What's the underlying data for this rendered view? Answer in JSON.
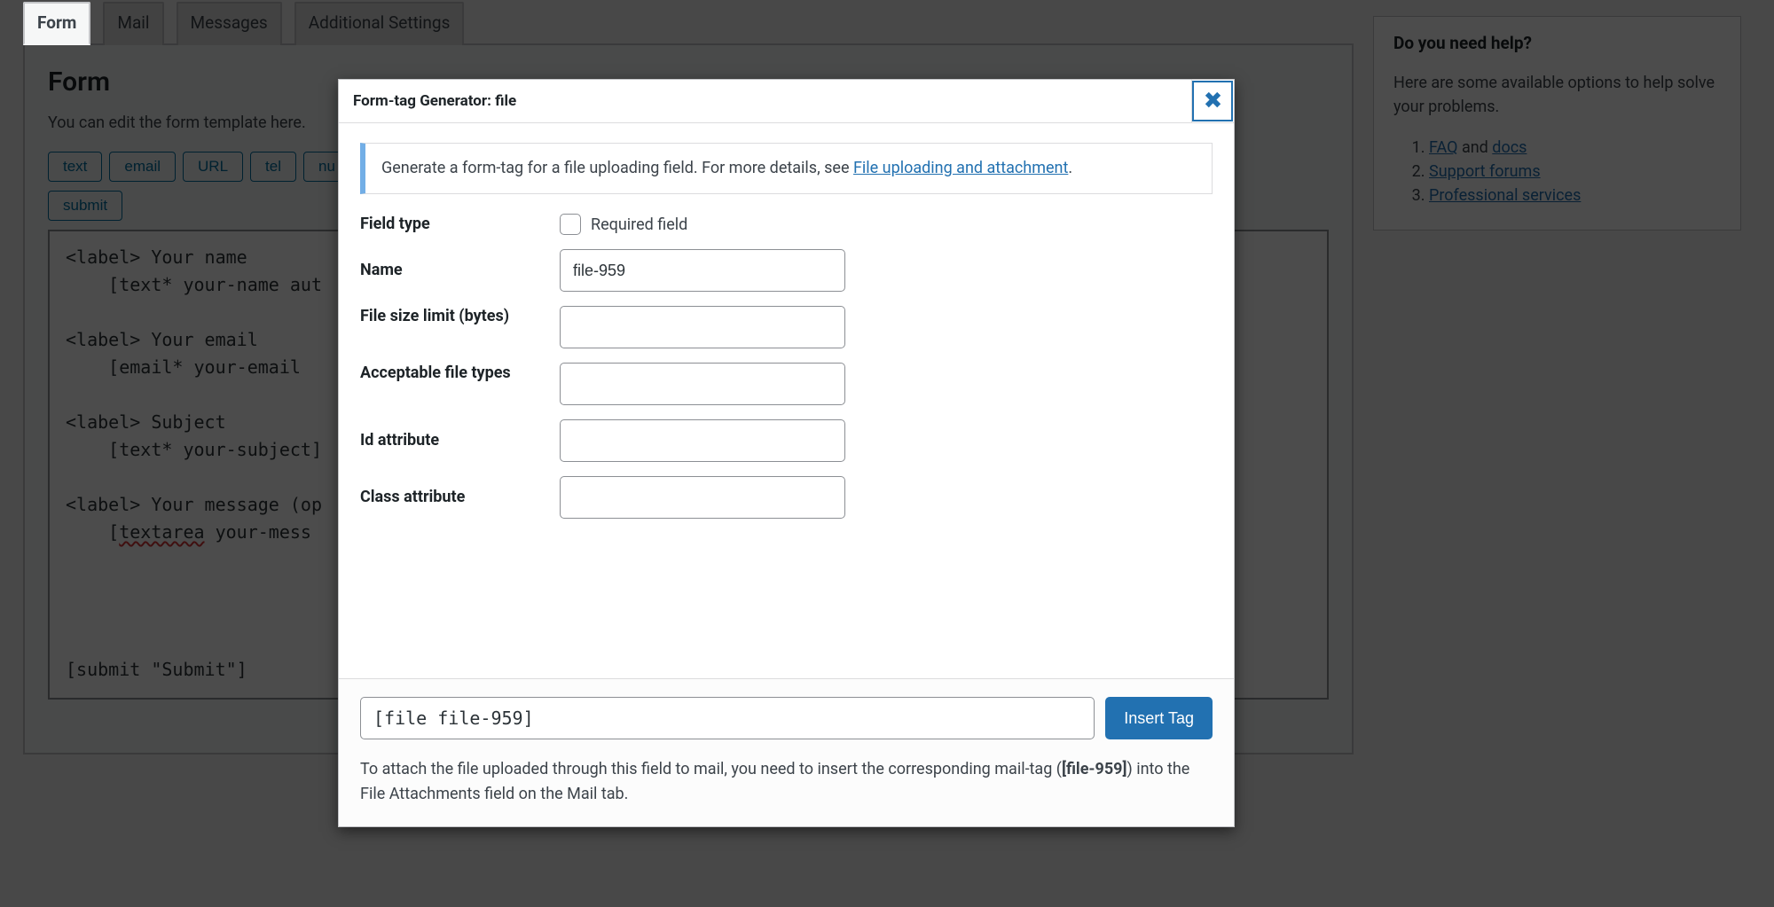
{
  "tabs": {
    "items": [
      "Form",
      "Mail",
      "Messages",
      "Additional Settings"
    ],
    "active_index": 0
  },
  "form_panel": {
    "heading": "Form",
    "description": "You can edit the form template here.",
    "tag_buttons_row1": [
      "text",
      "email",
      "URL",
      "tel",
      "nu"
    ],
    "tag_buttons_row2": [
      "submit"
    ],
    "code_lines": [
      "<label> Your name",
      "    [text* your-name aut",
      "",
      "<label> Your email",
      "    [email* your-email ",
      "",
      "<label> Subject",
      "    [text* your-subject]",
      "",
      "<label> Your message (op",
      "    [textarea your-mess",
      "",
      "",
      "",
      "",
      "[submit \"Submit\"]"
    ],
    "squiggle_word": "textarea"
  },
  "help": {
    "heading": "Do you need help?",
    "intro": "Here are some available options to help solve your problems.",
    "items": [
      {
        "prefix_link": "FAQ",
        "mid": " and ",
        "suffix_link": "docs"
      },
      {
        "prefix_link": "Support forums",
        "mid": "",
        "suffix_link": ""
      },
      {
        "prefix_link": "Professional services",
        "mid": "",
        "suffix_link": ""
      }
    ]
  },
  "modal": {
    "title": "Form-tag Generator: file",
    "info_pre": "Generate a form-tag for a file uploading field. For more details, see ",
    "info_link": "File uploading and attachment",
    "info_post": ".",
    "fields": {
      "field_type_label": "Field type",
      "required_label": "Required field",
      "name_label": "Name",
      "name_value": "file-959",
      "filesize_label": "File size limit (bytes)",
      "filesize_value": "",
      "accept_label": "Acceptable file types",
      "accept_value": "",
      "id_label": "Id attribute",
      "id_value": "",
      "class_label": "Class attribute",
      "class_value": ""
    },
    "output_tag": "[file file-959]",
    "insert_label": "Insert Tag",
    "footer_note_pre": "To attach the file uploaded through this field to mail, you need to insert the corresponding mail-tag (",
    "footer_note_tag": "[file-959]",
    "footer_note_post": ") into the File Attachments field on the Mail tab."
  }
}
